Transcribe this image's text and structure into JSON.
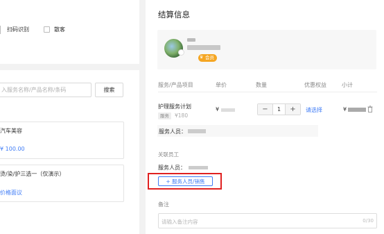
{
  "left": {
    "scan_label": "扫码识别",
    "walkin_label": "散客",
    "search": {
      "placeholder": "入服务名称/产品名称/条码",
      "button": "搜索"
    },
    "cards": [
      {
        "title": "汽车美容",
        "price": "¥ 100.00"
      },
      {
        "title": "烫/染/护三选一（仅演示）",
        "price": "价格面议"
      }
    ]
  },
  "right": {
    "title": "结算信息",
    "member": {
      "tag": "会员",
      "tag_icon": "crown-icon"
    },
    "table": {
      "headers": [
        "服务/产品项目",
        "单价",
        "数量",
        "优惠权益",
        "小计"
      ],
      "rows": [
        {
          "name": "护理服务计划",
          "tag": "服务",
          "orig_price": "¥180",
          "unit_price": "¥",
          "qty": "1",
          "discount": "请选择",
          "subtotal": "¥",
          "staff_label": "服务人员："
        }
      ]
    },
    "related": {
      "title": "关联员工",
      "staff_label": "服务人员：",
      "add_button": "+ 服务人员/销售"
    },
    "remark": {
      "label": "备注",
      "placeholder": "请输入备注内容",
      "count": "0/30"
    }
  },
  "colors": {
    "accent": "#3e7bf6",
    "highlight": "#e02020",
    "badge": "#f5a623"
  }
}
